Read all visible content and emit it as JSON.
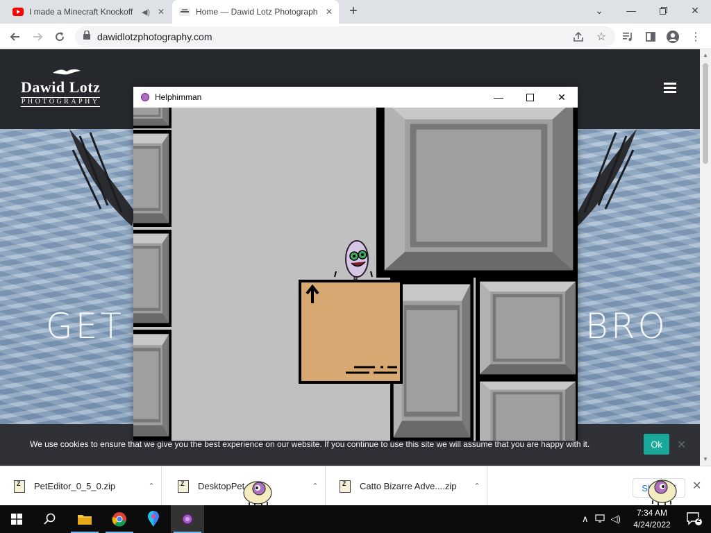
{
  "browser": {
    "tabs": [
      {
        "title": "I made a Minecraft Knockoff",
        "audio": true,
        "active": false
      },
      {
        "title": "Home — Dawid Lotz Photograph",
        "active": true
      }
    ],
    "url": "dawidlotzphotography.com"
  },
  "website": {
    "logo_name": "Dawid Lotz",
    "logo_sub": "PHOTOGRAPHY",
    "hero_left": "GET",
    "hero_right": "BRO",
    "cookie_message": "We use cookies to ensure that we give you the best experience on our website. If you continue to use this site we will assume that you are happy with it.",
    "cookie_ok": "Ok",
    "cookie_close": "✕"
  },
  "game": {
    "window_title": "Helphimman",
    "minimize": "—",
    "close": "✕"
  },
  "downloads": {
    "items": [
      {
        "name": "PetEditor_0_5_0.zip"
      },
      {
        "name": "DesktopPet."
      },
      {
        "name": "Catto Bizarre Adve....zip"
      }
    ],
    "show_all": "Show all"
  },
  "taskbar": {
    "time": "7:34 AM",
    "date": "4/24/2022",
    "notifications": "2"
  },
  "colors": {
    "accent_teal": "#1aa89a",
    "site_dark": "#25282c",
    "crate": "#d8a872"
  }
}
